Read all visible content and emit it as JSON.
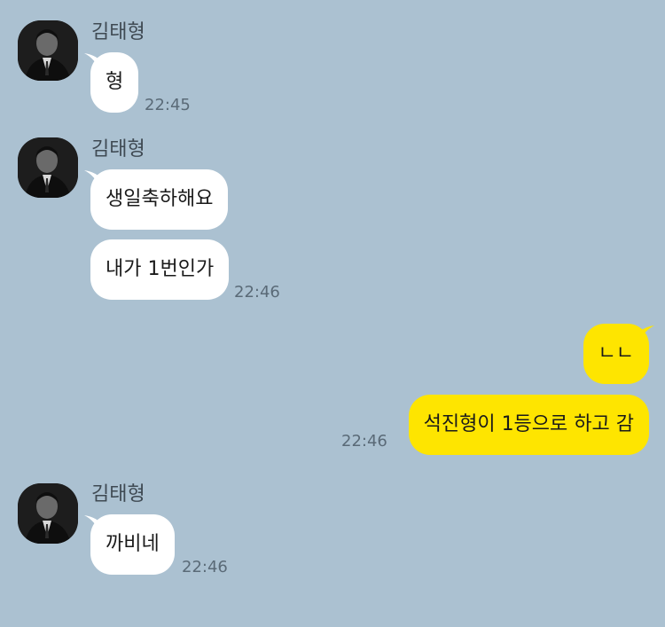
{
  "chat": {
    "colors": {
      "background": "#abc1d1",
      "incoming_bubble": "#ffffff",
      "outgoing_bubble": "#fee500"
    },
    "groups": [
      {
        "sender": "김태형",
        "messages": [
          "형"
        ],
        "time": "22:45"
      },
      {
        "sender": "김태형",
        "messages": [
          "생일축하해요",
          "내가 1번인가"
        ],
        "time": "22:46"
      },
      {
        "messages": [
          "ㄴㄴ",
          "석진형이 1등으로 하고 감"
        ],
        "time": "22:46"
      },
      {
        "sender": "김태형",
        "messages": [
          "까비네"
        ],
        "time": "22:46"
      }
    ]
  }
}
